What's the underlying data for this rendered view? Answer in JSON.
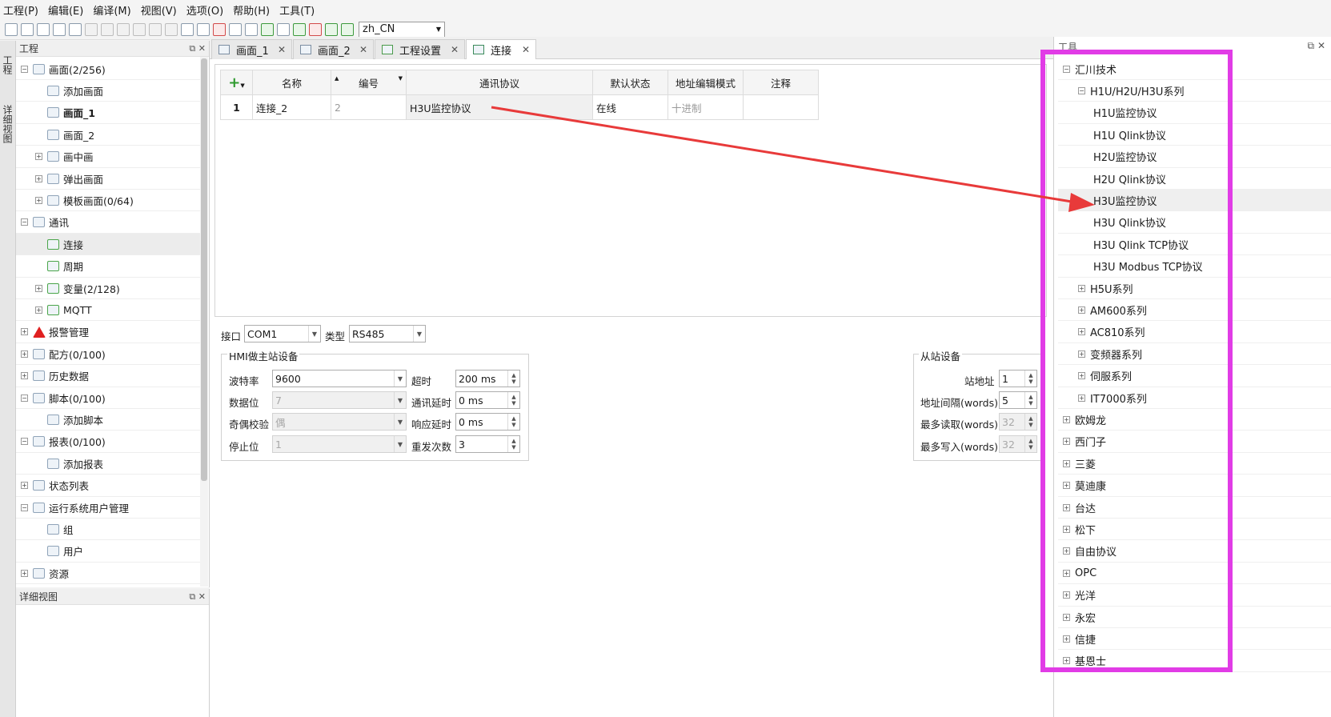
{
  "menu": [
    "工程(P)",
    "编辑(E)",
    "编译(M)",
    "视图(V)",
    "选项(O)",
    "帮助(H)",
    "工具(T)"
  ],
  "toolbar": {
    "language": "zh_CN"
  },
  "side_tabs": [
    "工程",
    "详细视图"
  ],
  "project_panel": {
    "title": "工程",
    "items": [
      {
        "label": "画面(2/256)",
        "level": 0,
        "exp": "-"
      },
      {
        "label": "添加画面",
        "level": 1
      },
      {
        "label": "画面_1",
        "level": 1,
        "bold": true
      },
      {
        "label": "画面_2",
        "level": 1
      },
      {
        "label": "画中画",
        "level": 1,
        "exp": "+"
      },
      {
        "label": "弹出画面",
        "level": 1,
        "exp": "+"
      },
      {
        "label": "模板画面(0/64)",
        "level": 1,
        "exp": "+"
      },
      {
        "label": "通讯",
        "level": 0,
        "exp": "-"
      },
      {
        "label": "连接",
        "level": 1,
        "selected": true
      },
      {
        "label": "周期",
        "level": 1
      },
      {
        "label": "变量(2/128)",
        "level": 1,
        "exp": "+"
      },
      {
        "label": "MQTT",
        "level": 1,
        "exp": "+"
      },
      {
        "label": "报警管理",
        "level": 0,
        "exp": "+",
        "icon": "warning"
      },
      {
        "label": "配方(0/100)",
        "level": 0,
        "exp": "+"
      },
      {
        "label": "历史数据",
        "level": 0,
        "exp": "+"
      },
      {
        "label": "脚本(0/100)",
        "level": 0,
        "exp": "-"
      },
      {
        "label": "添加脚本",
        "level": 1
      },
      {
        "label": "报表(0/100)",
        "level": 0,
        "exp": "-"
      },
      {
        "label": "添加报表",
        "level": 1
      },
      {
        "label": "状态列表",
        "level": 0,
        "exp": "+"
      },
      {
        "label": "运行系统用户管理",
        "level": 0,
        "exp": "-"
      },
      {
        "label": "组",
        "level": 1
      },
      {
        "label": "用户",
        "level": 1
      },
      {
        "label": "资源",
        "level": 0,
        "exp": "+"
      }
    ]
  },
  "detail_panel": {
    "title": "详细视图"
  },
  "tabs": [
    "画面_1",
    "画面_2",
    "工程设置",
    "连接"
  ],
  "grid": {
    "headers": [
      "名称",
      "编号",
      "通讯协议",
      "默认状态",
      "地址编辑模式",
      "注释"
    ],
    "row": {
      "index": "1",
      "name": "连接_2",
      "number": "2",
      "protocol": "H3U监控协议",
      "status": "在线",
      "mode": "十进制",
      "note": ""
    }
  },
  "comm": {
    "port_label": "接口",
    "port": "COM1",
    "type_label": "类型",
    "type": "RS485",
    "master_title": "HMI做主站设备",
    "baud_label": "波特率",
    "baud": "9600",
    "timeout_label": "超时",
    "timeout": "200 ms",
    "databits_label": "数据位",
    "databits": "7",
    "comm_delay_label": "通讯延时",
    "comm_delay": "0 ms",
    "parity_label": "奇偶校验",
    "parity": "偶",
    "resp_delay_label": "响应延时",
    "resp_delay": "0 ms",
    "stopbits_label": "停止位",
    "stopbits": "1",
    "retry_label": "重发次数",
    "retry": "3",
    "slave_title": "从站设备",
    "station_label": "站地址",
    "station": "1",
    "interval_label": "地址间隔(words)",
    "interval": "5",
    "maxread_label": "最多读取(words)",
    "maxread": "32",
    "maxwrite_label": "最多写入(words)",
    "maxwrite": "32"
  },
  "tools_panel": {
    "title": "工具",
    "items": [
      {
        "label": "汇川技术",
        "level": 0,
        "exp": "-"
      },
      {
        "label": "H1U/H2U/H3U系列",
        "level": 1,
        "exp": "-"
      },
      {
        "label": "H1U监控协议",
        "level": 2
      },
      {
        "label": "H1U Qlink协议",
        "level": 2
      },
      {
        "label": "H2U监控协议",
        "level": 2
      },
      {
        "label": "H2U Qlink协议",
        "level": 2
      },
      {
        "label": "H3U监控协议",
        "level": 2,
        "highlight": true
      },
      {
        "label": "H3U Qlink协议",
        "level": 2
      },
      {
        "label": "H3U Qlink TCP协议",
        "level": 2
      },
      {
        "label": "H3U Modbus TCP协议",
        "level": 2
      },
      {
        "label": "H5U系列",
        "level": 1,
        "exp": "+"
      },
      {
        "label": "AM600系列",
        "level": 1,
        "exp": "+"
      },
      {
        "label": "AC810系列",
        "level": 1,
        "exp": "+"
      },
      {
        "label": "变频器系列",
        "level": 1,
        "exp": "+"
      },
      {
        "label": "伺服系列",
        "level": 1,
        "exp": "+"
      },
      {
        "label": "IT7000系列",
        "level": 1,
        "exp": "+"
      },
      {
        "label": "欧姆龙",
        "level": 0,
        "exp": "+"
      },
      {
        "label": "西门子",
        "level": 0,
        "exp": "+"
      },
      {
        "label": "三菱",
        "level": 0,
        "exp": "+"
      },
      {
        "label": "莫迪康",
        "level": 0,
        "exp": "+"
      },
      {
        "label": "台达",
        "level": 0,
        "exp": "+"
      },
      {
        "label": "松下",
        "level": 0,
        "exp": "+"
      },
      {
        "label": "自由协议",
        "level": 0,
        "exp": "+"
      },
      {
        "label": "OPC",
        "level": 0,
        "exp": "+"
      },
      {
        "label": "光洋",
        "level": 0,
        "exp": "+"
      },
      {
        "label": "永宏",
        "level": 0,
        "exp": "+"
      },
      {
        "label": "信捷",
        "level": 0,
        "exp": "+"
      },
      {
        "label": "基恩士",
        "level": 0,
        "exp": "+"
      }
    ]
  },
  "colors": {
    "annotation_box": "#e13ce6",
    "annotation_arrow": "#e83a3a"
  }
}
